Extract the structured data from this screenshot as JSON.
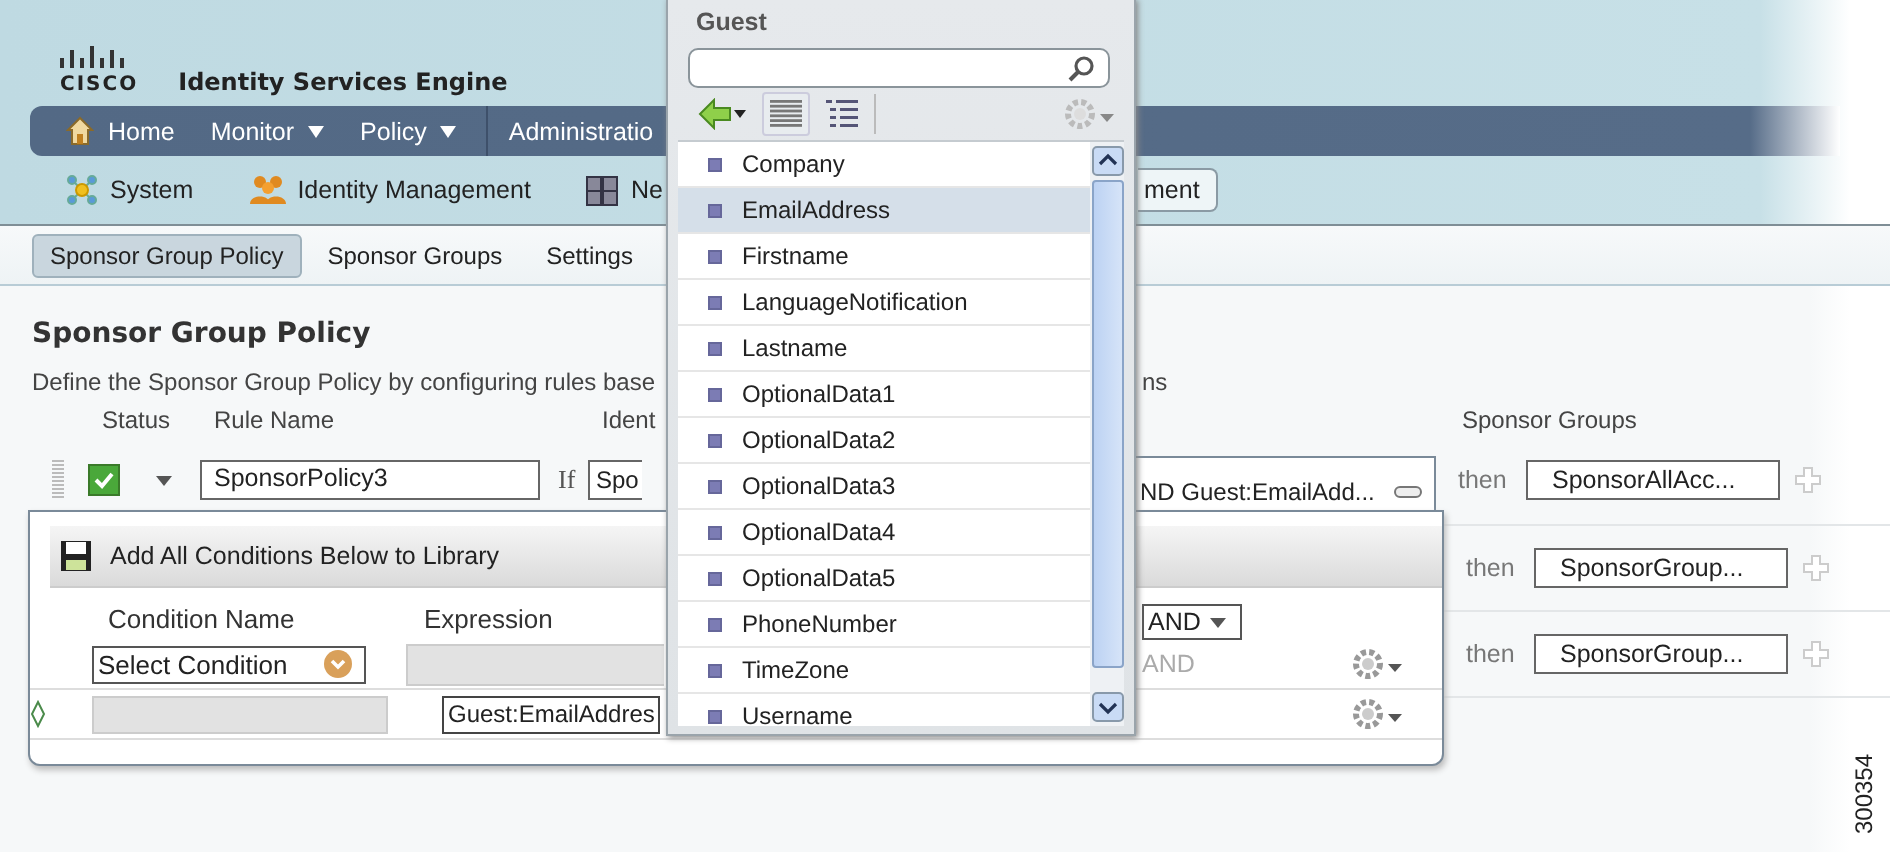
{
  "header": {
    "logo": "CISCO",
    "title": "Identity Services Engine"
  },
  "nav": [
    {
      "label": "Home",
      "kind": "home"
    },
    {
      "label": "Monitor",
      "kind": "menu"
    },
    {
      "label": "Policy",
      "kind": "menu"
    },
    {
      "label": "Administratio",
      "kind": "plain"
    }
  ],
  "subnav": [
    {
      "label": "System"
    },
    {
      "label": "Identity Management"
    },
    {
      "label": "Ne"
    }
  ],
  "subnav_tab": "ment",
  "tabs": [
    {
      "label": "Sponsor Group Policy",
      "selected": true
    },
    {
      "label": "Sponsor Groups",
      "selected": false
    },
    {
      "label": "Settings",
      "selected": false
    }
  ],
  "policy": {
    "heading": "Sponsor Group Policy",
    "description": "Define the Sponsor Group Policy by configuring rules base",
    "description_tail": "ns",
    "columns": [
      "Status",
      "Rule Name",
      "Ident",
      "Sponsor Groups"
    ]
  },
  "rules": [
    {
      "enabled": true,
      "name": "SponsorPolicy3",
      "if": "If",
      "identity": "Spo",
      "expression": "ND Guest:EmailAdd...",
      "then": "then",
      "group": "SponsorAllAcc..."
    },
    {
      "then": "then",
      "group": "SponsorGroup..."
    },
    {
      "then": "then",
      "group": "SponsorGroup..."
    }
  ],
  "condition_popup": {
    "title": "Add All Conditions Below to Library",
    "columns": [
      "Condition Name",
      "Expression"
    ],
    "operator": "AND",
    "conditions": [
      {
        "kind": "select",
        "name": "Select Condition",
        "operator": "AND"
      },
      {
        "kind": "new",
        "value": "Guest:EmailAddres"
      }
    ]
  },
  "attribute_picker": {
    "title": "Guest",
    "items": [
      {
        "label": "Company",
        "selected": false
      },
      {
        "label": "EmailAddress",
        "selected": true
      },
      {
        "label": "Firstname",
        "selected": false
      },
      {
        "label": "LanguageNotification",
        "selected": false
      },
      {
        "label": "Lastname",
        "selected": false
      },
      {
        "label": "OptionalData1",
        "selected": false
      },
      {
        "label": "OptionalData2",
        "selected": false
      },
      {
        "label": "OptionalData3",
        "selected": false
      },
      {
        "label": "OptionalData4",
        "selected": false
      },
      {
        "label": "OptionalData5",
        "selected": false
      },
      {
        "label": "PhoneNumber",
        "selected": false
      },
      {
        "label": "TimeZone",
        "selected": false
      },
      {
        "label": "Username",
        "selected": false
      }
    ]
  },
  "figure_id": "300354"
}
